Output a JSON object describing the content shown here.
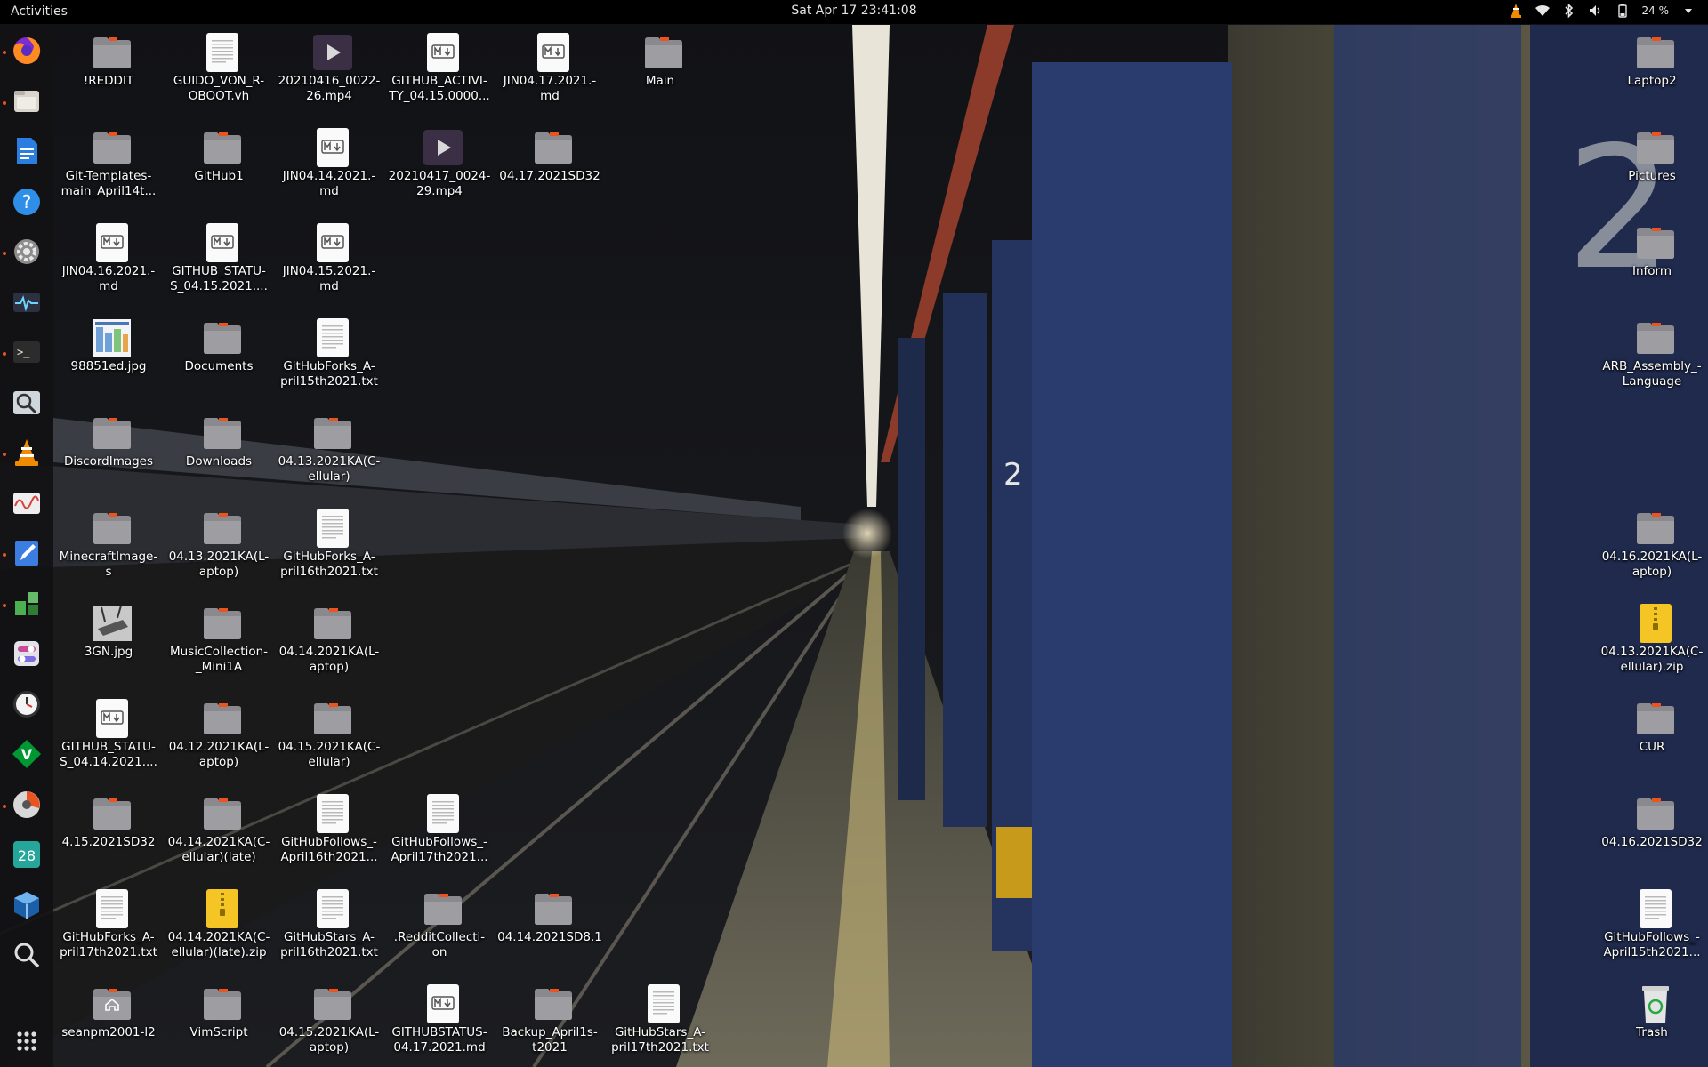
{
  "topbar": {
    "activities": "Activities",
    "clock": "Sat Apr 17  23:41:08",
    "battery": "24 %"
  },
  "dock": [
    {
      "name": "firefox-icon",
      "running": true
    },
    {
      "name": "files-icon",
      "running": true
    },
    {
      "name": "writer-document-icon",
      "running": false
    },
    {
      "name": "help-icon",
      "running": false
    },
    {
      "name": "settings-gear-icon",
      "running": true
    },
    {
      "name": "system-monitor-icon",
      "running": false
    },
    {
      "name": "terminal-icon",
      "running": true
    },
    {
      "name": "image-viewer-icon",
      "running": false
    },
    {
      "name": "vlc-cone-icon",
      "running": true
    },
    {
      "name": "activity-chart-icon",
      "running": false
    },
    {
      "name": "text-editor-icon",
      "running": true
    },
    {
      "name": "extensions-puzzle-icon",
      "running": true
    },
    {
      "name": "tweaks-icon",
      "running": false
    },
    {
      "name": "clock-icon",
      "running": false
    },
    {
      "name": "vim-icon",
      "running": false
    },
    {
      "name": "disk-usage-icon",
      "running": true
    },
    {
      "name": "calendar-icon",
      "running": false
    },
    {
      "name": "virtualbox-icon",
      "running": false
    },
    {
      "name": "search-icon",
      "running": false
    }
  ],
  "calendar_day": "28",
  "colors": {
    "folder": "#8a8a8e",
    "folder_tab": "#e95420",
    "accent": "#e95420"
  },
  "desktop_icons": [
    {
      "label": "!REDDIT",
      "type": "folder",
      "col": 0,
      "row": 0
    },
    {
      "label": "GUIDO_VON_R-\nOBOOT.vh",
      "type": "text",
      "col": 1,
      "row": 0
    },
    {
      "label": "20210416_0022-\n26.mp4",
      "type": "video",
      "col": 2,
      "row": 0
    },
    {
      "label": "GITHUB_ACTIVI-\nTY_04.15.0000...",
      "type": "markdown",
      "col": 3,
      "row": 0
    },
    {
      "label": "JIN04.17.2021.-\nmd",
      "type": "markdown",
      "col": 4,
      "row": 0
    },
    {
      "label": "Main",
      "type": "folder",
      "col": 5,
      "row": 0
    },
    {
      "label": "Git-Templates-\nmain_April14t...",
      "type": "folder",
      "col": 0,
      "row": 1
    },
    {
      "label": "GitHub1",
      "type": "folder",
      "col": 1,
      "row": 1
    },
    {
      "label": "JIN04.14.2021.-\nmd",
      "type": "markdown",
      "col": 2,
      "row": 1
    },
    {
      "label": "20210417_0024-\n29.mp4",
      "type": "video",
      "col": 3,
      "row": 1
    },
    {
      "label": "04.17.2021SD32",
      "type": "folder",
      "col": 4,
      "row": 1
    },
    {
      "label": "JIN04.16.2021.-\nmd",
      "type": "markdown",
      "col": 0,
      "row": 2
    },
    {
      "label": "GITHUB_STATU-\nS_04.15.2021....",
      "type": "markdown",
      "col": 1,
      "row": 2
    },
    {
      "label": "JIN04.15.2021.-\nmd",
      "type": "markdown",
      "col": 2,
      "row": 2
    },
    {
      "label": "98851ed.jpg",
      "type": "image-chart",
      "col": 0,
      "row": 3
    },
    {
      "label": "Documents",
      "type": "folder",
      "col": 1,
      "row": 3
    },
    {
      "label": "GitHubForks_A-\npril15th2021.txt",
      "type": "text",
      "col": 2,
      "row": 3
    },
    {
      "label": "DiscordImages",
      "type": "folder",
      "col": 0,
      "row": 4
    },
    {
      "label": "Downloads",
      "type": "folder",
      "col": 1,
      "row": 4
    },
    {
      "label": "04.13.2021KA(C-\nellular)",
      "type": "folder",
      "col": 2,
      "row": 4
    },
    {
      "label": "MinecraftImage-\ns",
      "type": "folder",
      "col": 0,
      "row": 5
    },
    {
      "label": "04.13.2021KA(L-\naptop)",
      "type": "folder",
      "col": 1,
      "row": 5
    },
    {
      "label": "GitHubForks_A-\npril16th2021.txt",
      "type": "text",
      "col": 2,
      "row": 5
    },
    {
      "label": "3GN.jpg",
      "type": "image-device",
      "col": 0,
      "row": 6
    },
    {
      "label": "MusicCollection-\n_Mini1A",
      "type": "folder",
      "col": 1,
      "row": 6
    },
    {
      "label": "04.14.2021KA(L-\naptop)",
      "type": "folder",
      "col": 2,
      "row": 6
    },
    {
      "label": "GITHUB_STATU-\nS_04.14.2021....",
      "type": "markdown",
      "col": 0,
      "row": 7
    },
    {
      "label": "04.12.2021KA(L-\naptop)",
      "type": "folder",
      "col": 1,
      "row": 7
    },
    {
      "label": "04.15.2021KA(C-\nellular)",
      "type": "folder",
      "col": 2,
      "row": 7
    },
    {
      "label": "4.15.2021SD32",
      "type": "folder",
      "col": 0,
      "row": 8
    },
    {
      "label": "04.14.2021KA(C-\nellular)(late)",
      "type": "folder",
      "col": 1,
      "row": 8
    },
    {
      "label": "GitHubFollows_-\nApril16th2021...",
      "type": "text",
      "col": 2,
      "row": 8
    },
    {
      "label": "GitHubFollows_-\nApril17th2021...",
      "type": "text",
      "col": 3,
      "row": 8
    },
    {
      "label": "GitHubForks_A-\npril17th2021.txt",
      "type": "text",
      "col": 0,
      "row": 9
    },
    {
      "label": "04.14.2021KA(C-\nellular)(late).zip",
      "type": "zip",
      "col": 1,
      "row": 9
    },
    {
      "label": "GitHubStars_A-\npril16th2021.txt",
      "type": "text",
      "col": 2,
      "row": 9
    },
    {
      "label": ".RedditCollecti-\non",
      "type": "folder",
      "col": 3,
      "row": 9
    },
    {
      "label": "04.14.2021SD8.1",
      "type": "folder",
      "col": 4,
      "row": 9
    },
    {
      "label": "seanpm2001-l2",
      "type": "home",
      "col": 0,
      "row": 10
    },
    {
      "label": "VimScript",
      "type": "folder",
      "col": 1,
      "row": 10
    },
    {
      "label": "04.15.2021KA(L-\naptop)",
      "type": "folder",
      "col": 2,
      "row": 10
    },
    {
      "label": "GITHUBSTATUS-\n04.17.2021.md",
      "type": "markdown",
      "col": 3,
      "row": 10
    },
    {
      "label": "Backup_April1s-\nt2021",
      "type": "folder",
      "col": 4,
      "row": 10
    },
    {
      "label": "GitHubStars_A-\npril17th2021.txt",
      "type": "text",
      "col": 5,
      "row": 10
    },
    {
      "label": "Laptop2",
      "type": "folder",
      "col": "right",
      "row": 0
    },
    {
      "label": "Pictures",
      "type": "folder",
      "col": "right",
      "row": 1
    },
    {
      "label": "Inform",
      "type": "folder",
      "col": "right",
      "row": 2
    },
    {
      "label": "ARB_Assembly_-\nLanguage",
      "type": "folder",
      "col": "right",
      "row": 3
    },
    {
      "label": "04.16.2021KA(L-\naptop)",
      "type": "folder",
      "col": "right",
      "row": 5
    },
    {
      "label": "04.13.2021KA(C-\nellular).zip",
      "type": "zip",
      "col": "right",
      "row": 6
    },
    {
      "label": "CUR",
      "type": "folder",
      "col": "right",
      "row": 7
    },
    {
      "label": "04.16.2021SD32",
      "type": "folder",
      "col": "right",
      "row": 8
    },
    {
      "label": "GitHubFollows_-\nApril15th2021...",
      "type": "text",
      "col": "right",
      "row": 9
    },
    {
      "label": "Trash",
      "type": "trash",
      "col": "right",
      "row": 10
    }
  ]
}
